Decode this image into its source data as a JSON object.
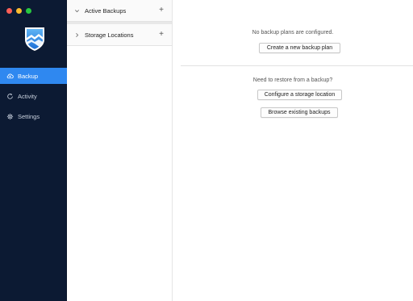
{
  "window": {
    "controls": [
      "close",
      "minimize",
      "zoom"
    ]
  },
  "sidebar": {
    "logo_icon": "mountain-shield-logo",
    "items": [
      {
        "label": "Backup",
        "icon": "backup-icon",
        "active": true
      },
      {
        "label": "Activity",
        "icon": "activity-icon",
        "active": false
      },
      {
        "label": "Settings",
        "icon": "gear-icon",
        "active": false
      }
    ]
  },
  "middle": {
    "sections": [
      {
        "label": "Active Backups",
        "expanded": true,
        "chevron": "chevron-down-icon",
        "action": "+"
      },
      {
        "label": "Storage Locations",
        "expanded": false,
        "chevron": "chevron-right-icon",
        "action": "+"
      }
    ]
  },
  "main": {
    "backup_message": "No backup plans are configured.",
    "create_button": "Create a new backup plan",
    "restore_message": "Need to restore from a backup?",
    "configure_button": "Configure a storage location",
    "browse_button": "Browse existing backups"
  },
  "colors": {
    "sidebar_bg": "#0c1a33",
    "accent": "#2f88f0"
  }
}
